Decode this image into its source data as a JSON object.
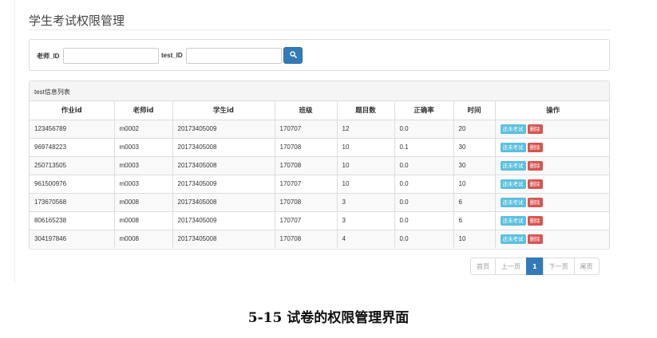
{
  "page": {
    "title": "学生考试权限管理"
  },
  "search": {
    "teacher_label": "老师_ID",
    "teacher_value": "",
    "test_label": "test_ID",
    "test_value": "",
    "button_icon": "search-icon"
  },
  "list": {
    "heading": "test信息列表",
    "columns": [
      "作业id",
      "老师id",
      "学生id",
      "班级",
      "题目数",
      "正确率",
      "时间",
      "操作"
    ],
    "rows": [
      [
        "123456789",
        "m0002",
        "20173405009",
        "170707",
        "12",
        "0.0",
        "20"
      ],
      [
        "969748223",
        "m0003",
        "20173405008",
        "170708",
        "10",
        "0.1",
        "30"
      ],
      [
        "250713505",
        "m0003",
        "20173405008",
        "170708",
        "10",
        "0.0",
        "30"
      ],
      [
        "961500976",
        "m0003",
        "20173405009",
        "170707",
        "10",
        "0.0",
        "10"
      ],
      [
        "173670568",
        "m0008",
        "20173405008",
        "170708",
        "3",
        "0.0",
        "6"
      ],
      [
        "806165238",
        "m0008",
        "20173405009",
        "170707",
        "3",
        "0.0",
        "6"
      ],
      [
        "304197846",
        "m0008",
        "20173405008",
        "170708",
        "4",
        "0.0",
        "10"
      ]
    ],
    "action_exam_label": "还未考试",
    "action_delete_label": "删除"
  },
  "pagination": {
    "first": "首页",
    "prev": "上一页",
    "current": "1",
    "next": "下一页",
    "last": "尾页"
  },
  "caption": "5-15 试卷的权限管理界面",
  "colors": {
    "primary": "#337ab7",
    "info": "#5bc0de",
    "danger": "#d9534f"
  }
}
